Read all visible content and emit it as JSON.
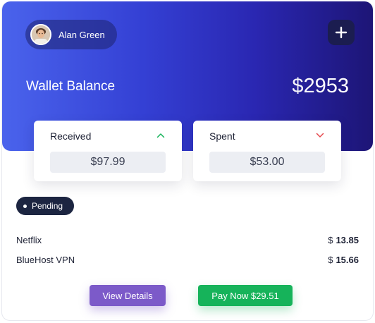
{
  "user": {
    "name": "Alan Green"
  },
  "wallet": {
    "label": "Wallet Balance",
    "currency": "$",
    "amount": "2953"
  },
  "received": {
    "label": "Received",
    "value": "$97.99",
    "arrow_color": "#16b35a"
  },
  "spent": {
    "label": "Spent",
    "value": "$53.00",
    "arrow_color": "#e5484d"
  },
  "status": {
    "label": "Pending"
  },
  "transactions": [
    {
      "name": "Netflix",
      "currency": "$",
      "amount": "13.85"
    },
    {
      "name": "BlueHost VPN",
      "currency": "$",
      "amount": "15.66"
    }
  ],
  "actions": {
    "view_label": "View Details",
    "pay_label": "Pay Now $29.51"
  },
  "colors": {
    "hero_start": "#4a63ec",
    "hero_end": "#1d1576",
    "view": "#7c5ac9",
    "pay": "#16b35a"
  },
  "icons": {
    "add": "plus-icon",
    "received": "chevron-up-icon",
    "spent": "chevron-down-icon"
  }
}
